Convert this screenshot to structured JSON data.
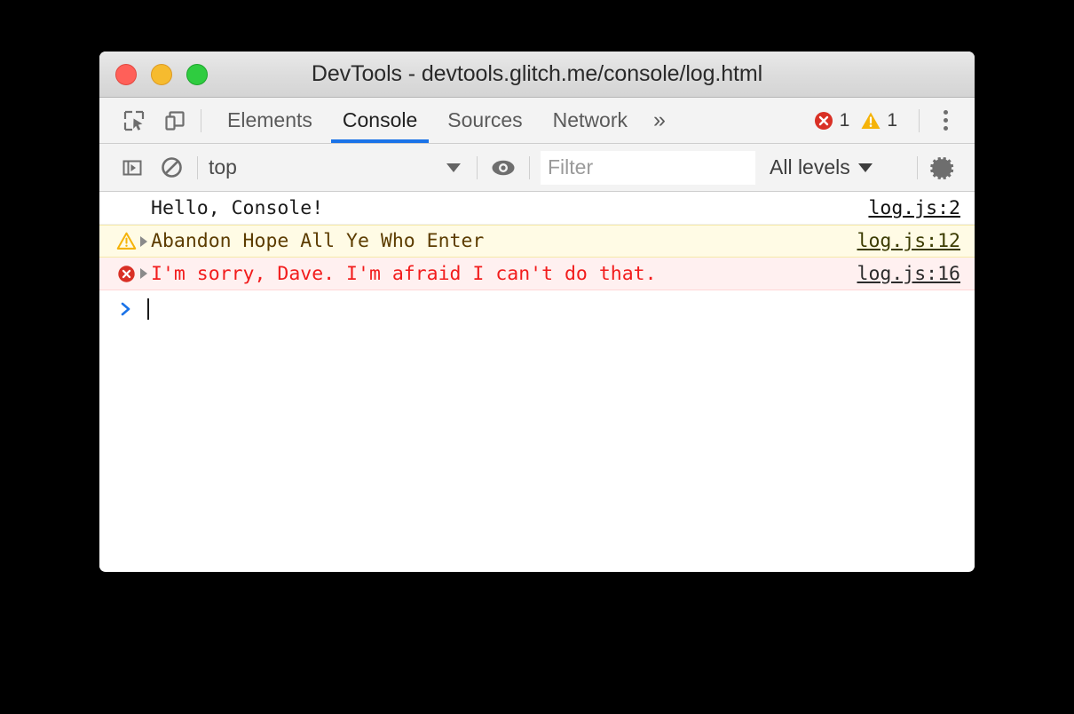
{
  "window": {
    "title": "DevTools - devtools.glitch.me/console/log.html",
    "traffic_lights": [
      {
        "name": "close-button",
        "color": "#ff6059"
      },
      {
        "name": "minimize-button",
        "color": "#f6bb2f"
      },
      {
        "name": "maximize-button",
        "color": "#2fcc40"
      }
    ]
  },
  "tabbar": {
    "icons": [
      {
        "name": "inspect-element-icon",
        "title": "Inspect"
      },
      {
        "name": "device-toolbar-icon",
        "title": "Toggle device toolbar"
      }
    ],
    "tabs": [
      {
        "label": "Elements",
        "active": false
      },
      {
        "label": "Console",
        "active": true
      },
      {
        "label": "Sources",
        "active": false
      },
      {
        "label": "Network",
        "active": false
      }
    ],
    "more_label": "»",
    "error_count": "1",
    "warning_count": "1",
    "menu_label": "more-options"
  },
  "console_toolbar": {
    "sidebar_toggle": "console-sidebar-toggle-icon",
    "clear_label": "clear-console-icon",
    "context": "top",
    "eye_label": "live-expression-icon",
    "filter_placeholder": "Filter",
    "filter_value": "",
    "levels_label": "All levels",
    "settings_label": "settings-gear-icon"
  },
  "console_messages": [
    {
      "type": "log",
      "icon": null,
      "disclosure": false,
      "text": "Hello, Console!",
      "source": "log.js:2"
    },
    {
      "type": "warn",
      "icon": "warning-icon",
      "disclosure": true,
      "text": "Abandon Hope All Ye Who Enter",
      "source": "log.js:12"
    },
    {
      "type": "error",
      "icon": "error-icon",
      "disclosure": true,
      "text": "I'm sorry, Dave. I'm afraid I can't do that.",
      "source": "log.js:16"
    }
  ],
  "prompt": {
    "symbol": ">",
    "value": ""
  },
  "colors": {
    "accent_blue": "#1a73e8",
    "error_red": "#f21c1c",
    "warning_yellow": "#f5b309",
    "warn_bg": "#fffbe5",
    "error_bg": "#fff0f0",
    "toolbar_bg": "#f3f3f3",
    "titlebar_bg": "#dcdcdc"
  }
}
